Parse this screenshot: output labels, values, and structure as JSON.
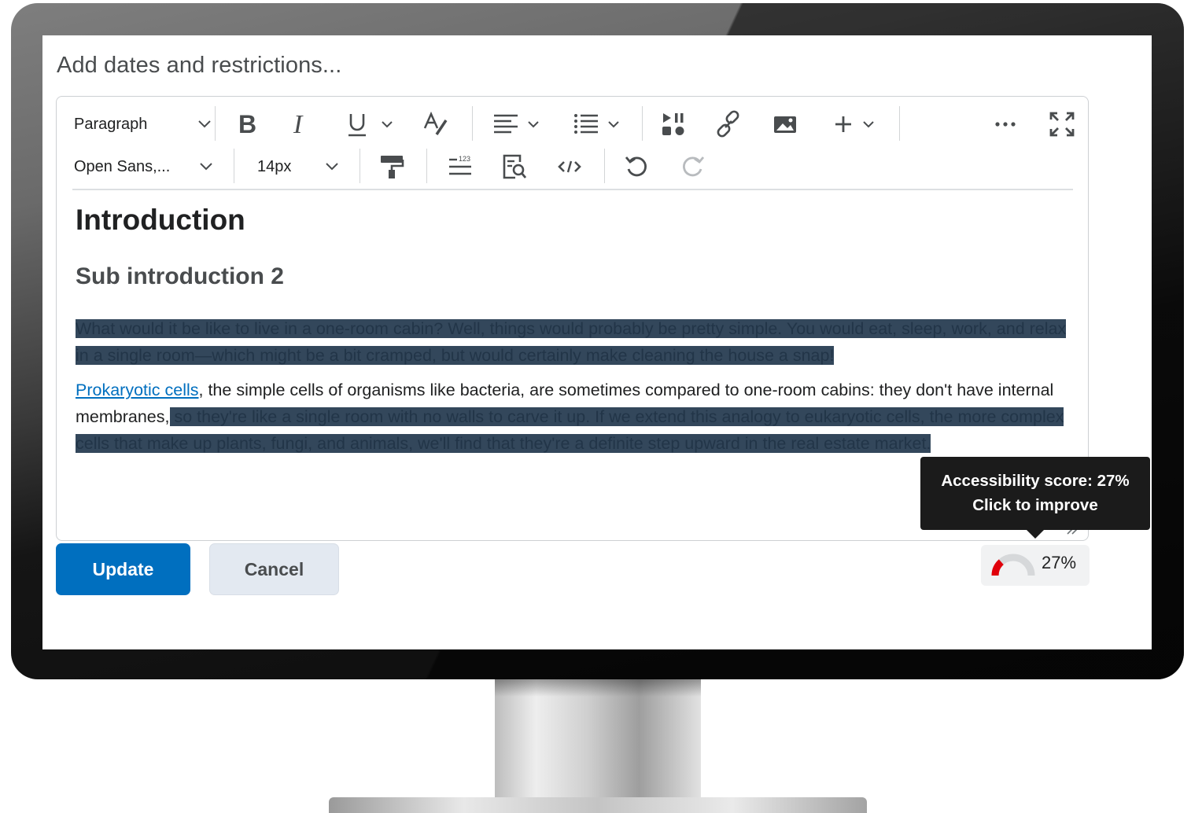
{
  "page": {
    "heading": "Add dates and restrictions..."
  },
  "toolbar": {
    "block_format": "Paragraph",
    "font_family": "Open Sans,...",
    "font_size": "14px",
    "icons": [
      "bold-icon",
      "italic-icon",
      "underline-icon",
      "strikethrough-format-icon",
      "align-left-icon",
      "bulleted-list-icon",
      "media-icon",
      "link-icon",
      "image-icon",
      "insert-plus-icon",
      "more-icon",
      "fullscreen-icon",
      "format-painter-icon",
      "line-numbering-icon",
      "find-replace-icon",
      "source-code-icon",
      "undo-icon",
      "redo-icon"
    ]
  },
  "content": {
    "heading1": "Introduction",
    "heading2": "Sub introduction 2",
    "para1_selected": "What would it be like to live in a one-room cabin? Well, things would probably be pretty simple. You would eat, sleep, work, and relax in a single room—which might be a bit cramped, but would certainly make cleaning the house a snap!",
    "para2_link": "Prokaryotic cells",
    "para2_plain": ", the simple cells of organisms like bacteria, are sometimes compared to one-room cabins: they don't have internal membranes,",
    "para2_selected": " so they're like a single room with no walls to carve it up. If we extend this analogy to eukaryotic cells, the more complex cells that make up plants, fungi, and animals, we'll find that they're a definite step upward in the real estate market."
  },
  "buttons": {
    "update": "Update",
    "cancel": "Cancel"
  },
  "accessibility": {
    "score_fraction": 0.27,
    "score_label": "27%",
    "tooltip_line1": "Accessibility score: 27%",
    "tooltip_line2": "Click to improve",
    "gauge_color": "#e0000b",
    "gauge_track_color": "#d6d8da"
  },
  "colors": {
    "primary": "#006fbf",
    "selection": "#33475b",
    "link": "#006fbf"
  }
}
